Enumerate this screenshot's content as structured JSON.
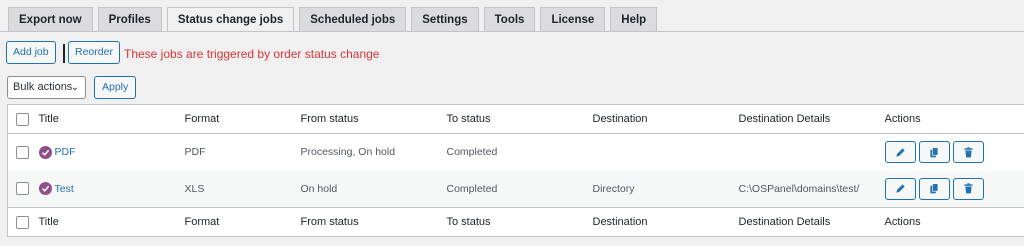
{
  "tabs": [
    "Export now",
    "Profiles",
    "Status change jobs",
    "Scheduled jobs",
    "Settings",
    "Tools",
    "License",
    "Help"
  ],
  "toolbar": {
    "add_job": "Add job",
    "reorder": "Reorder",
    "notice": "These jobs are triggered by order status change"
  },
  "bulk": {
    "select_value": "Bulk actions",
    "apply": "Apply"
  },
  "table": {
    "headers": [
      "Title",
      "Format",
      "From status",
      "To status",
      "Destination",
      "Destination Details",
      "Actions"
    ],
    "rows": [
      {
        "title": "PDF",
        "format": "PDF",
        "from": "Processing, On hold",
        "to": "Completed",
        "destination": "",
        "details": ""
      },
      {
        "title": "Test",
        "format": "XLS",
        "from": "On hold",
        "to": "Completed",
        "destination": "Directory",
        "details": "C:\\OSPanel\\domains\\test/"
      }
    ]
  },
  "colors": {
    "accent": "#2271b1",
    "notice": "#d63638",
    "check": "#8e4f8b"
  },
  "icons": [
    "pencil-icon",
    "copy-icon",
    "trash-icon",
    "check-circle-icon",
    "chevron-down-icon"
  ]
}
